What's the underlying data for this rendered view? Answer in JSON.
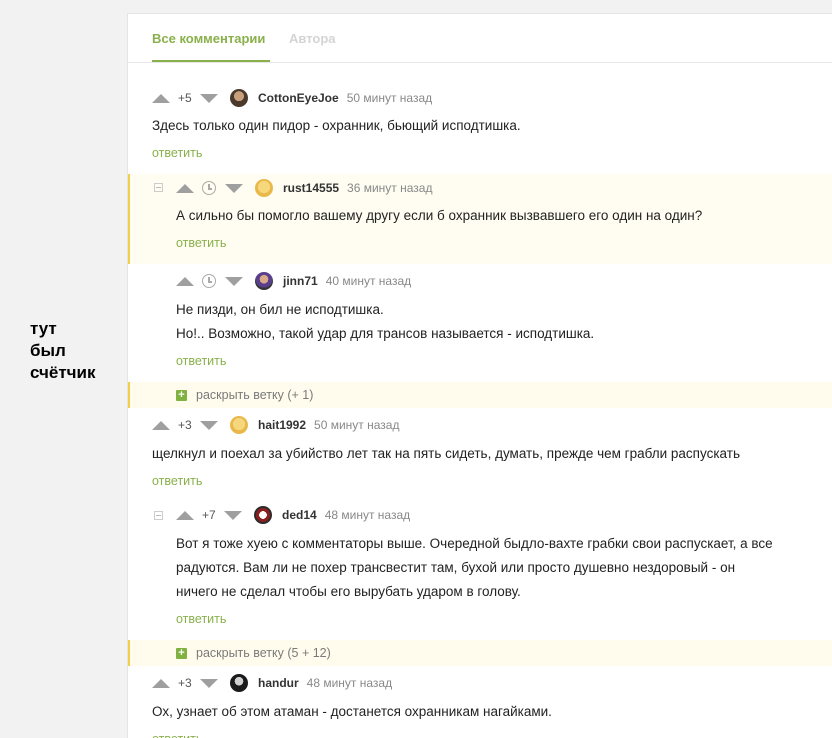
{
  "side_note": [
    "тут",
    "был",
    "счётчик"
  ],
  "tabs": {
    "all": "Все комментарии",
    "author": "Автора"
  },
  "reply_label": "ответить",
  "comments": [
    {
      "rating": "+5",
      "user": "CottonEyeJoe",
      "time": "50 минут назад",
      "lines": [
        "Здесь только один пидор - охранник, бьющий исподтишка."
      ]
    },
    {
      "rating": "",
      "user": "rust14555",
      "time": "36 минут назад",
      "lines": [
        "А сильно бы помогло вашему другу если б охранник вызвавшего его один на один?"
      ]
    },
    {
      "rating": "",
      "user": "jinn71",
      "time": "40 минут назад",
      "lines": [
        "Не пизди, он бил не исподтишка.",
        "Но!.. Возможно, такой удар для трансов называется - исподтишка."
      ]
    },
    {
      "rating": "+3",
      "user": "hait1992",
      "time": "50 минут назад",
      "lines": [
        "щелкнул и поехал за убийство лет так на пять сидеть, думать, прежде чем грабли распускать"
      ]
    },
    {
      "rating": "+7",
      "user": "ded14",
      "time": "48 минут назад",
      "lines": [
        "Вот я тоже хуею с комментаторы выше. Очередной быдло-вахте грабки свои распускает, а все",
        "радуются. Вам ли не похер трансвестит там, бухой или просто душевно нездоровый - он",
        "ничего не сделал чтобы его вырубать ударом в голову."
      ]
    },
    {
      "rating": "+3",
      "user": "handur",
      "time": "48 минут назад",
      "lines": [
        "Ох, узнает об этом атаман - достанется охранникам нагайками."
      ]
    }
  ],
  "expand": [
    {
      "label": "раскрыть ветку (+ 1)"
    },
    {
      "label": "раскрыть ветку (5 + 12)"
    }
  ],
  "colors": {
    "accent": "#8ab04c",
    "highlight_bar": "#f2cf4a",
    "highlight_bg": "#fffdf1"
  },
  "icons": {
    "vote_up": "triangle-up",
    "vote_down": "triangle-down",
    "pending": "clock-icon",
    "expand": "plus-icon"
  }
}
